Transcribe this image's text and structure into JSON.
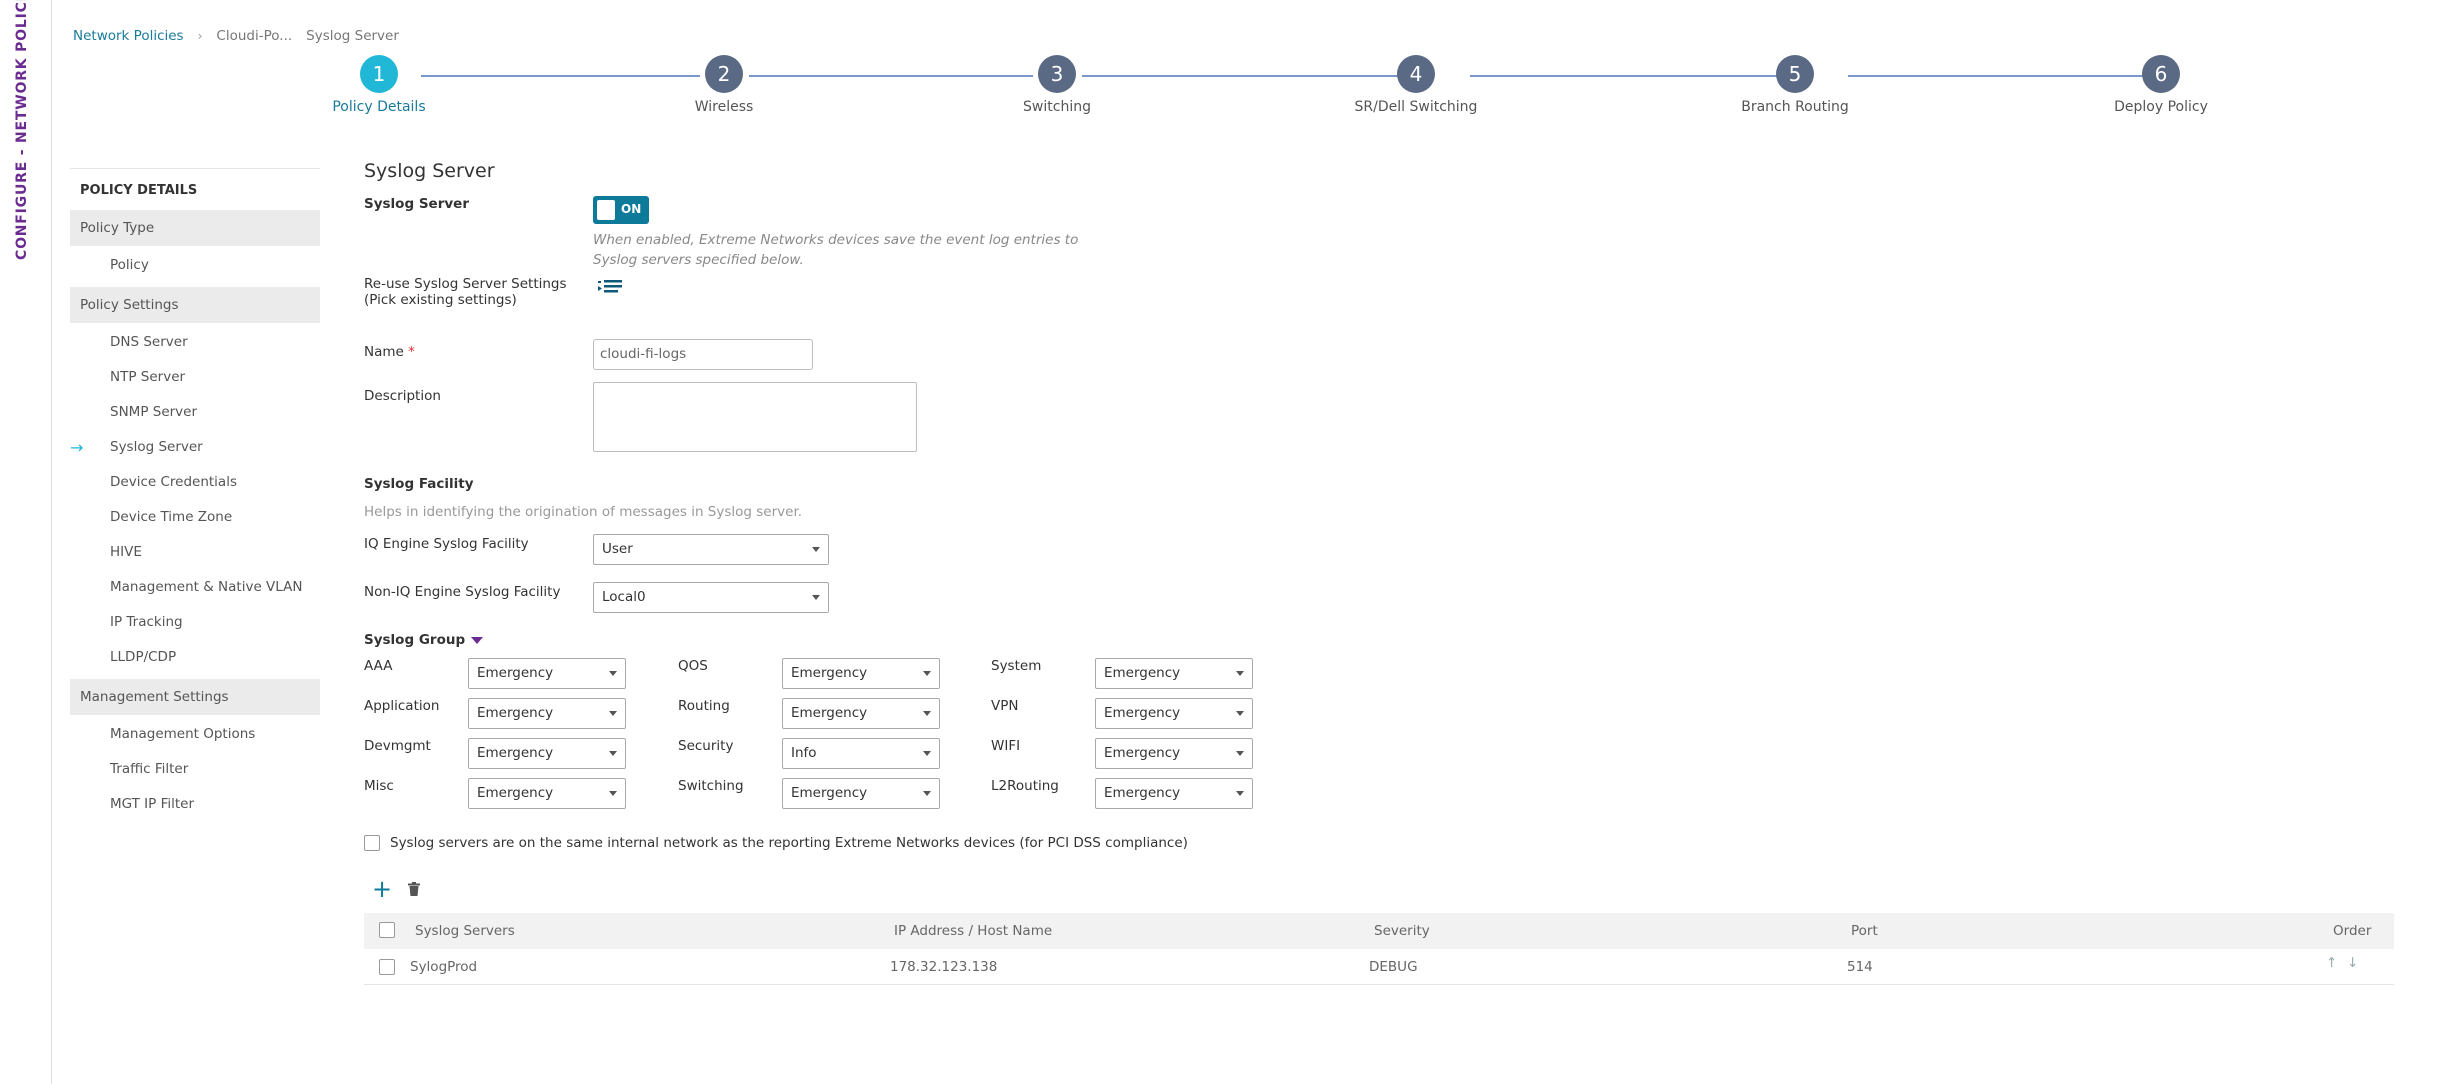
{
  "sidebar_title": "CONFIGURE - NETWORK POLICIES",
  "breadcrumb": {
    "root": "Network Policies",
    "middle": "Cloudi-Po...",
    "current": "Syslog Server",
    "sep": "›"
  },
  "steps": [
    {
      "num": "1",
      "label": "Policy Details"
    },
    {
      "num": "2",
      "label": "Wireless"
    },
    {
      "num": "3",
      "label": "Switching"
    },
    {
      "num": "4",
      "label": "SR/Dell Switching"
    },
    {
      "num": "5",
      "label": "Branch Routing"
    },
    {
      "num": "6",
      "label": "Deploy Policy"
    }
  ],
  "nav": {
    "header": "POLICY DETAILS",
    "policy_type": "Policy Type",
    "policy": "Policy",
    "policy_settings": "Policy Settings",
    "items": [
      "DNS Server",
      "NTP Server",
      "SNMP Server",
      "Syslog Server",
      "Device Credentials",
      "Device Time Zone",
      "HIVE",
      "Management & Native VLAN",
      "IP Tracking",
      "LLDP/CDP"
    ],
    "management_settings": "Management Settings",
    "mgmt_items": [
      "Management Options",
      "Traffic Filter",
      "MGT IP Filter"
    ],
    "arrow": "→"
  },
  "form": {
    "page_title": "Syslog Server",
    "syslog_server_label": "Syslog Server",
    "toggle_text": "ON",
    "hint": "When enabled, Extreme Networks devices save the event log entries to Syslog servers specified below.",
    "reuse_label_1": "Re-use Syslog Server Settings",
    "reuse_label_2": "(Pick existing settings)",
    "name_label": "Name",
    "required_mark": "*",
    "name_value": "cloudi-fi-logs",
    "description_label": "Description",
    "facility_title": "Syslog Facility",
    "facility_hint": "Helps in identifying the origination of messages in Syslog server.",
    "iq_facility_label": "IQ Engine Syslog Facility",
    "iq_facility_value": "User",
    "noniq_facility_label": "Non-IQ Engine Syslog Facility",
    "noniq_facility_value": "Local0",
    "group_title": "Syslog Group",
    "pci_label": "Syslog servers are on the same internal network as the reporting Extreme Networks devices (for PCI DSS compliance)"
  },
  "groups": [
    {
      "label": "AAA",
      "value": "Emergency"
    },
    {
      "label": "QOS",
      "value": "Emergency"
    },
    {
      "label": "System",
      "value": "Emergency"
    },
    {
      "label": "Application",
      "value": "Emergency"
    },
    {
      "label": "Routing",
      "value": "Emergency"
    },
    {
      "label": "VPN",
      "value": "Emergency"
    },
    {
      "label": "Devmgmt",
      "value": "Emergency"
    },
    {
      "label": "Security",
      "value": "Info"
    },
    {
      "label": "WIFI",
      "value": "Emergency"
    },
    {
      "label": "Misc",
      "value": "Emergency"
    },
    {
      "label": "Switching",
      "value": "Emergency"
    },
    {
      "label": "L2Routing",
      "value": "Emergency"
    }
  ],
  "table": {
    "headers": [
      "Syslog Servers",
      "IP Address / Host Name",
      "Severity",
      "Port",
      "Order"
    ],
    "rows": [
      {
        "name": "SylogProd",
        "ip": "178.32.123.138",
        "severity": "DEBUG",
        "port": "514"
      }
    ],
    "add": "+",
    "up": "↑",
    "down": "↓"
  }
}
